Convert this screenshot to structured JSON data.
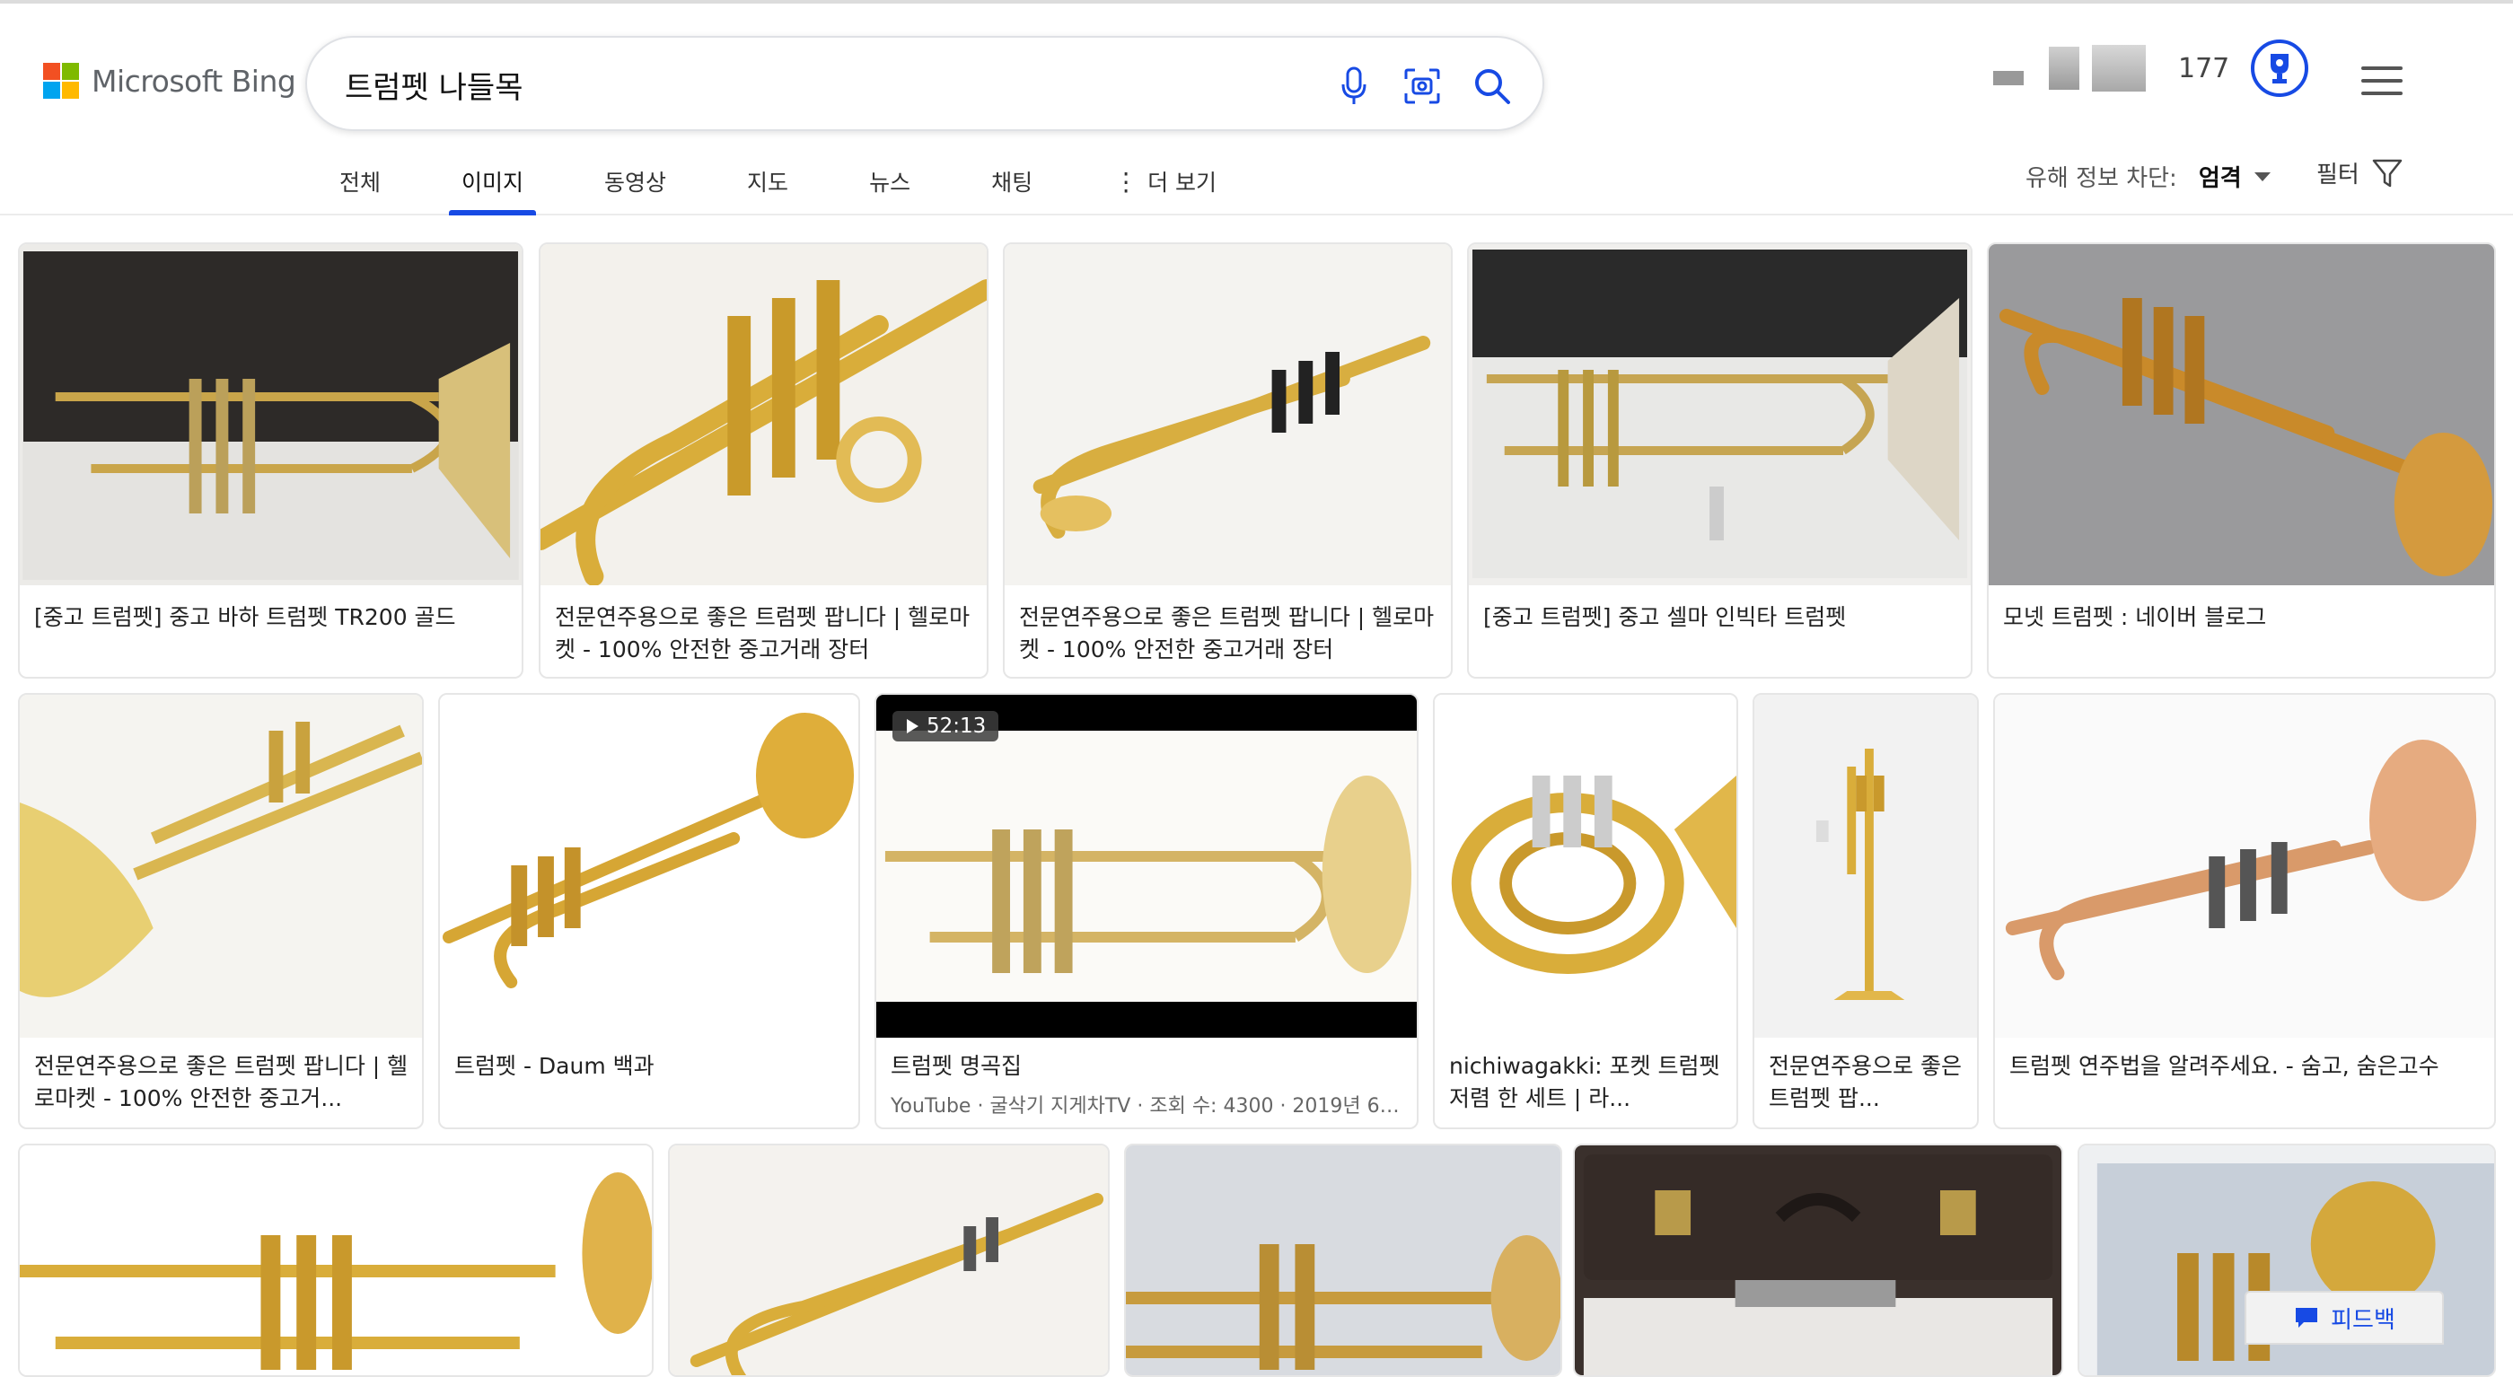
{
  "brand": {
    "name": "Microsoft Bing",
    "colors": [
      "#f25022",
      "#7fba00",
      "#00a4ef",
      "#ffb900"
    ]
  },
  "search": {
    "query": "트럼펫 나들목",
    "icons": [
      "microphone-icon",
      "visual-search-icon",
      "search-icon"
    ]
  },
  "account": {
    "points": "177",
    "icon": "rewards-trophy-icon"
  },
  "tabs": [
    {
      "label": "전체"
    },
    {
      "label": "이미지"
    },
    {
      "label": "동영상"
    },
    {
      "label": "지도"
    },
    {
      "label": "뉴스"
    },
    {
      "label": "채팅"
    },
    {
      "label": "더 보기"
    }
  ],
  "active_tab": "이미지",
  "safesearch": {
    "label": "유해 정보 차단:",
    "value": "엄격"
  },
  "filter": {
    "label": "필터"
  },
  "results": [
    {
      "caption": "[중고 트럼펫] 중고 바하 트럼펫 TR200 골드"
    },
    {
      "caption": "전문연주용으로 좋은 트럼펫 팝니다 | 헬로마켓 - 100% 안전한 중고거래 장터"
    },
    {
      "caption": "전문연주용으로 좋은 트럼펫 팝니다 | 헬로마켓 - 100% 안전한 중고거래 장터"
    },
    {
      "caption": "[중고 트럼펫] 중고 셀마 인빅타 트럼펫"
    },
    {
      "caption": "모넷 트럼펫 : 네이버 블로그"
    },
    {
      "caption": "전문연주용으로 좋은 트럼펫 팝니다 | 헬로마켓 - 100% 안전한 중고거..."
    },
    {
      "caption": "트럼펫 - Daum 백과"
    },
    {
      "caption": "트럼펫 명곡집",
      "source": "YouTube · 굴삭기 지게차TV · 조회 수: 4300 · 2019년 6월...",
      "duration": "52:13"
    },
    {
      "caption": "nichiwagakki: 포켓 트럼펫 저렴 한 세트 | 라..."
    },
    {
      "caption": "전문연주용으로 좋은 트럼펫 팝..."
    },
    {
      "caption": "트럼펫 연주법을 알려주세요. - 숨고, 숨은고수"
    }
  ],
  "feedback": {
    "label": "피드백"
  },
  "accent": "#174ae4"
}
